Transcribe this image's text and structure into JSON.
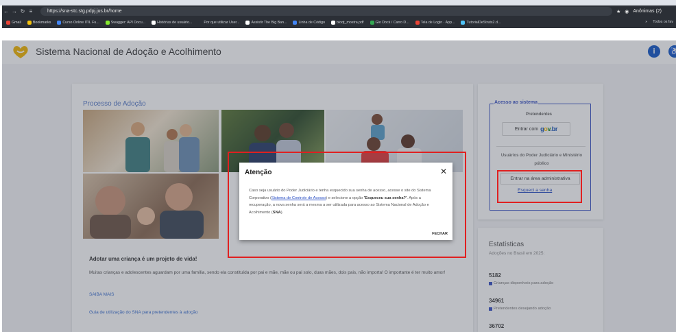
{
  "browser": {
    "url": "https://sna-stc.stg.pdpj.jus.br/home",
    "profile_label": "Anônimas (2)",
    "bookmarks": [
      "Gmail",
      "Bookmarks",
      "Curso Online ITIL Fu...",
      "Swagger: API Docu...",
      "Histórias de usuário...",
      "Por que utilizar User...",
      "Assistir The Big Ban...",
      "Linha de Código",
      "bloqt_mostra.pdf",
      "Glo Dock / Carro D...",
      "Tela de Login · App...",
      "TutorialDeStruts2.d..."
    ],
    "all_favorites": "Todos os fav"
  },
  "app": {
    "title": "Sistema Nacional de Adoção e Acolhimento",
    "info_icon": "i",
    "accessibility_icon": "♿"
  },
  "main": {
    "section_title": "Processo de Adoção",
    "headline": "Adotar uma criança é um projeto de vida!",
    "description": "Muitas crianças e adolescentes aguardam por uma família, sendo ela constituída por pai e mãe, mãe ou pai solo, duas mães, dois pais, não importa! O importante é ter muito amor!",
    "saiba_mais": "SAIBA MAIS",
    "guide_link": "Guia de utilização do SNA para pretendentes à adoção"
  },
  "access": {
    "legend": "Acesso ao sistema",
    "pretendentes": "Pretendentes",
    "entrar_com": "Entrar com",
    "gov_logo": "gov.br",
    "usuarios": "Usuários do Poder Judiciário e Ministério público",
    "admin_button": "Entrar na área administrativa",
    "forgot": "Esqueci a senha"
  },
  "stats": {
    "title": "Estatísticas",
    "subtitle": "Adoções no Brasil em 2025:",
    "items": [
      {
        "value": "5182",
        "label": "Crianças disponíveis para adoção"
      },
      {
        "value": "34961",
        "label": "Pretendentes desejando adoção"
      },
      {
        "value": "36702",
        "label": ""
      }
    ]
  },
  "modal": {
    "title": "Atenção",
    "close": "✕",
    "text_1": "Caso seja usuário do Poder Judiciário e tenha esquecido sua senha de acesso, acesse o site do Sistema Corporativo (",
    "link": "Sistema de Controle de Acesso",
    "text_2": ") e selecione a opção ",
    "bold_1": "'Esqueceu sua senha?'",
    "text_3": ". Após a recuperação, a nova senha será a mesma a ser utilizada para acesso ao Sistema Nacional de Adoção e Acolhimento (",
    "bold_2": "SNA",
    "text_4": ").",
    "button": "FECHAR"
  },
  "colors": {
    "accent": "#3a53c4",
    "link": "#2a4fc4",
    "highlight_box": "#e02020",
    "logo_yellow": "#f2b705"
  }
}
